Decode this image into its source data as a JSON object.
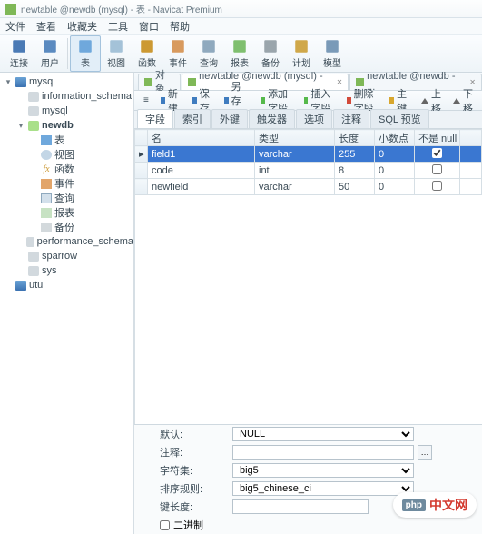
{
  "title": "newtable @newdb (mysql) - 表 - Navicat Premium",
  "menu": [
    "文件",
    "查看",
    "收藏夹",
    "工具",
    "窗口",
    "帮助"
  ],
  "toolbar": [
    {
      "label": "连接",
      "icon": "plug-icon"
    },
    {
      "label": "用户",
      "icon": "user-icon"
    },
    {
      "label": "表",
      "icon": "table-icon",
      "active": true
    },
    {
      "label": "视图",
      "icon": "view-icon"
    },
    {
      "label": "函数",
      "icon": "fn-icon"
    },
    {
      "label": "事件",
      "icon": "event-icon"
    },
    {
      "label": "查询",
      "icon": "query-icon"
    },
    {
      "label": "报表",
      "icon": "report-icon"
    },
    {
      "label": "备份",
      "icon": "backup-icon"
    },
    {
      "label": "计划",
      "icon": "schedule-icon"
    },
    {
      "label": "模型",
      "icon": "model-icon"
    }
  ],
  "tree": [
    {
      "depth": 0,
      "exp": "▾",
      "icon": "conn",
      "label": "mysql",
      "bold": false
    },
    {
      "depth": 1,
      "exp": "",
      "icon": "dbgrey",
      "label": "information_schema"
    },
    {
      "depth": 1,
      "exp": "",
      "icon": "dbgrey",
      "label": "mysql"
    },
    {
      "depth": 1,
      "exp": "▾",
      "icon": "db",
      "label": "newdb",
      "bold": true
    },
    {
      "depth": 2,
      "exp": "",
      "icon": "tbl",
      "label": "表"
    },
    {
      "depth": 2,
      "exp": "",
      "icon": "view",
      "label": "视图"
    },
    {
      "depth": 2,
      "exp": "",
      "icon": "fn",
      "label": "函数",
      "fntext": "fx"
    },
    {
      "depth": 2,
      "exp": "",
      "icon": "ev",
      "label": "事件"
    },
    {
      "depth": 2,
      "exp": "",
      "icon": "qr",
      "label": "查询"
    },
    {
      "depth": 2,
      "exp": "",
      "icon": "rp",
      "label": "报表"
    },
    {
      "depth": 2,
      "exp": "",
      "icon": "bk",
      "label": "备份"
    },
    {
      "depth": 1,
      "exp": "",
      "icon": "dbgrey",
      "label": "performance_schema"
    },
    {
      "depth": 1,
      "exp": "",
      "icon": "dbgrey",
      "label": "sparrow"
    },
    {
      "depth": 1,
      "exp": "",
      "icon": "dbgrey",
      "label": "sys"
    },
    {
      "depth": 0,
      "exp": "",
      "icon": "conn",
      "label": "utu"
    }
  ],
  "objtabs": [
    {
      "label": "对象",
      "sel": false,
      "close": false
    },
    {
      "label": "newtable @newdb (mysql) - ...",
      "sel": true,
      "close": true
    },
    {
      "label": "newtable @newdb - ...",
      "sel": false,
      "close": true
    }
  ],
  "designer_toolbar": [
    {
      "text": "新建",
      "icon": "blue"
    },
    {
      "text": "保存",
      "icon": "blue"
    },
    {
      "text": "另存为",
      "icon": "blue"
    },
    {
      "text": "添加字段",
      "icon": "green"
    },
    {
      "text": "插入字段",
      "icon": "green"
    },
    {
      "text": "删除字段",
      "icon": "red"
    },
    {
      "text": "主键",
      "icon": "gold"
    },
    {
      "text": "上移",
      "icon": "arrow"
    },
    {
      "text": "下移",
      "icon": "arrow"
    }
  ],
  "subtabs": [
    "字段",
    "索引",
    "外键",
    "触发器",
    "选项",
    "注释",
    "SQL 预览"
  ],
  "grid": {
    "headers": [
      "名",
      "类型",
      "长度",
      "小数点",
      "不是 null"
    ],
    "rows": [
      {
        "name": "field1",
        "type": "varchar",
        "len": "255",
        "dec": "0",
        "nn": true,
        "sel": true
      },
      {
        "name": "code",
        "type": "int",
        "len": "8",
        "dec": "0",
        "nn": false,
        "sel": false
      },
      {
        "name": "newfield",
        "type": "varchar",
        "len": "50",
        "dec": "0",
        "nn": false,
        "sel": false
      }
    ]
  },
  "props": {
    "default_label": "默认:",
    "default_value": "NULL",
    "comment_label": "注释:",
    "comment_value": "",
    "charset_label": "字符集:",
    "charset_value": "big5",
    "collation_label": "排序规则:",
    "collation_value": "big5_chinese_ci",
    "keylen_label": "键长度:",
    "keylen_value": "",
    "binary_label": "二进制"
  },
  "watermark": {
    "brand": "php",
    "text": "中文网"
  }
}
